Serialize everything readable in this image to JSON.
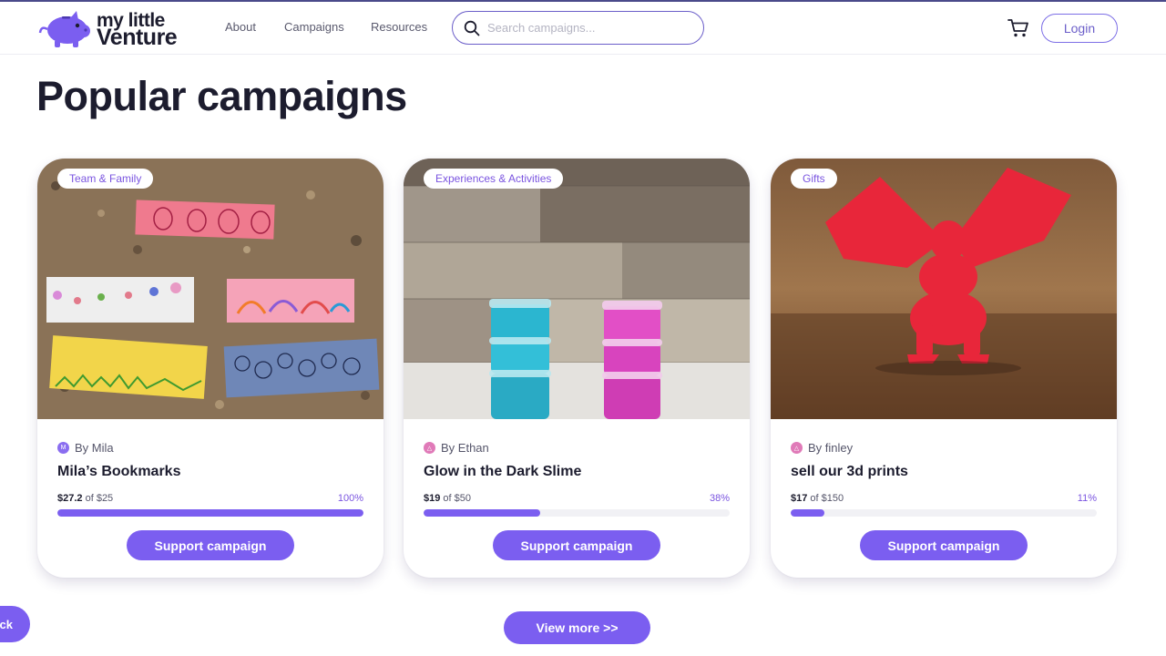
{
  "brand": {
    "name_line1": "my little",
    "name_line2": "Venture"
  },
  "nav": {
    "about": "About",
    "campaigns": "Campaigns",
    "resources": "Resources"
  },
  "search": {
    "placeholder": "Search campaigns..."
  },
  "header": {
    "login_label": "Login",
    "cart_icon": "cart-icon"
  },
  "page": {
    "title": "Popular campaigns",
    "view_more_label": "View more >>",
    "feedback_label": "ck"
  },
  "colors": {
    "accent": "#7b5ef0",
    "text": "#1c1c2e",
    "muted": "#55556a"
  },
  "campaigns": [
    {
      "tag": "Team & Family",
      "author": "By Mila",
      "avatar_color": "#8a6df0",
      "avatar_glyph": "M",
      "title": "Mila’s Bookmarks",
      "raised": "$27.2",
      "goal": "of $25",
      "percent_label": "100%",
      "progress": 1.0,
      "button": "Support campaign",
      "image_icon": "bookmarks-photo"
    },
    {
      "tag": "Experiences & Activities",
      "author": "By Ethan",
      "avatar_color": "#e07ab8",
      "avatar_glyph": "△",
      "title": "Glow in the Dark Slime",
      "raised": "$19",
      "goal": "of $50",
      "percent_label": "38%",
      "progress": 0.38,
      "button": "Support campaign",
      "image_icon": "slime-jars-photo"
    },
    {
      "tag": "Gifts",
      "author": "By finley",
      "avatar_color": "#e07ab8",
      "avatar_glyph": "△",
      "title": "sell our 3d prints",
      "raised": "$17",
      "goal": "of $150",
      "percent_label": "11%",
      "progress": 0.11,
      "button": "Support campaign",
      "image_icon": "dragon-print-photo"
    }
  ]
}
